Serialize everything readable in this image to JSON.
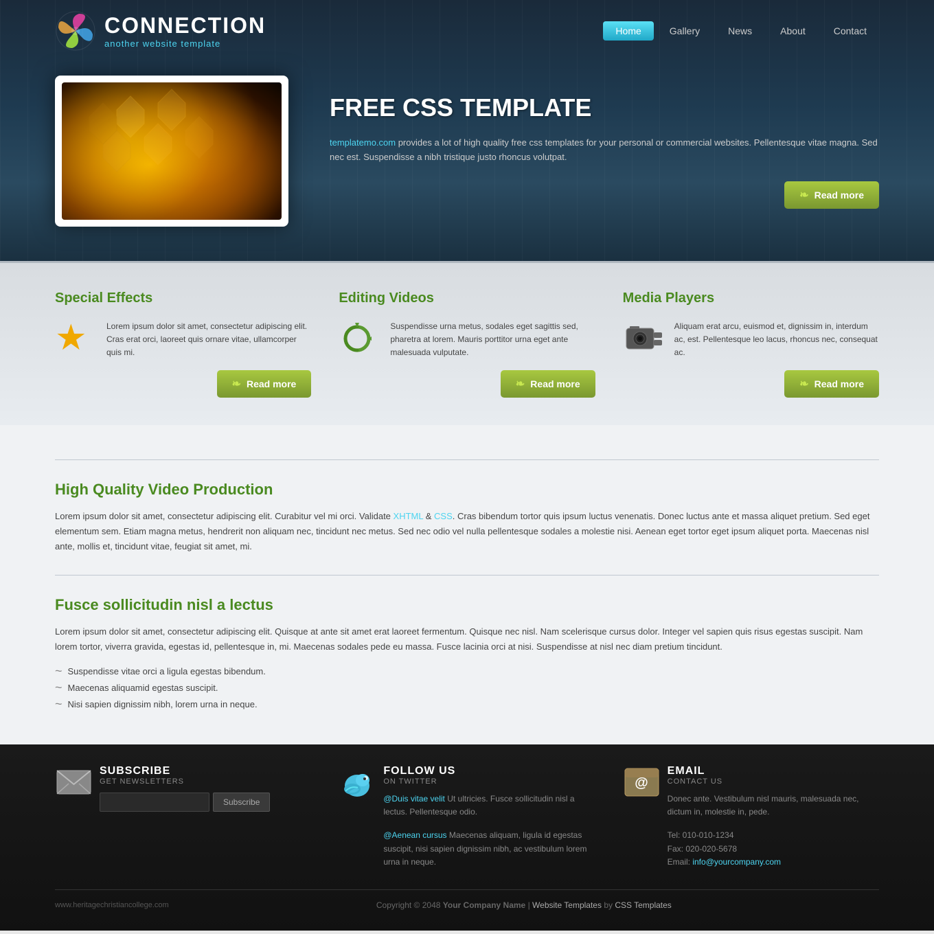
{
  "site": {
    "title": "CONNECTION",
    "subtitle": "another website template",
    "url": "www.heritagechristiancollege.com"
  },
  "nav": {
    "items": [
      {
        "label": "Home",
        "active": true
      },
      {
        "label": "Gallery",
        "active": false
      },
      {
        "label": "News",
        "active": false
      },
      {
        "label": "About",
        "active": false
      },
      {
        "label": "Contact",
        "active": false
      }
    ]
  },
  "hero": {
    "title": "FREE CSS TEMPLATE",
    "link_text": "templatemo.com",
    "description": " provides a lot of high quality free css templates for your personal or commercial websites. Pellentesque vitae magna. Sed nec est. Suspendisse a nibh tristique justo rhoncus volutpat.",
    "read_more": "Read more"
  },
  "features": {
    "items": [
      {
        "title": "Special Effects",
        "text": "Lorem ipsum dolor sit amet, consectetur adipiscing elit. Cras erat orci, laoreet quis ornare vitae, ullamcorper quis mi.",
        "read_more": "Read more",
        "icon": "star"
      },
      {
        "title": "Editing Videos",
        "text": "Suspendisse urna metus, sodales eget sagittis sed, pharetra at lorem. Mauris porttitor urna eget ante malesuada vulputate.",
        "read_more": "Read more",
        "icon": "refresh"
      },
      {
        "title": "Media Players",
        "text": "Aliquam erat arcu, euismod et, dignissim in, interdum ac, est. Pellentesque leo lacus, rhoncus nec, consequat ac.",
        "read_more": "Read more",
        "icon": "camera"
      }
    ]
  },
  "content": [
    {
      "title": "High Quality Video Production",
      "text1": "Lorem ipsum dolor sit amet, consectetur adipiscing elit. Curabitur vel mi orci. Validate ",
      "link1": "XHTML",
      "text2": " & ",
      "link2": "CSS",
      "text3": ". Cras bibendum tortor quis ipsum luctus venenatis. Donec luctus ante et massa aliquet pretium. Sed eget elementum sem. Etiam magna metus, hendrerit non aliquam nec, tincidunt nec metus. Sed nec odio vel nulla pellentesque sodales a molestie nisi. Aenean eget tortor eget ipsum aliquet porta. Maecenas nisl ante, mollis et, tincidunt vitae, feugiat sit amet, mi."
    },
    {
      "title": "Fusce sollicitudin nisl a lectus",
      "paragraph": "Lorem ipsum dolor sit amet, consectetur adipiscing elit. Quisque at ante sit amet erat laoreet fermentum. Quisque nec nisl. Nam scelerisque cursus dolor. Integer vel sapien quis risus egestas suscipit. Nam lorem tortor, viverra gravida, egestas id, pellentesque in, mi. Maecenas sodales pede eu massa. Fusce lacinia orci at nisi. Suspendisse at nisl nec diam pretium tincidunt.",
      "list": [
        "Suspendisse vitae orci a ligula egestas bibendum.",
        "Maecenas aliquamid egestas suscipit.",
        "Nisi sapien dignissim nibh, lorem urna in neque."
      ]
    }
  ],
  "footer": {
    "subscribe": {
      "title": "SUBSCRIBE",
      "subtitle": "GET NEWSLETTERS",
      "placeholder": "",
      "btn_label": "Subscribe"
    },
    "follow": {
      "title": "FOLLOW US",
      "subtitle": "ON TWITTER",
      "tweet1_user": "@Duis vitae velit",
      "tweet1_text": " Ut ultricies. Fusce sollicitudin nisl a lectus. Pellentesque odio.",
      "tweet2_user": "@Aenean cursus",
      "tweet2_text": " Maecenas aliquam, ligula id egestas suscipit, nisi sapien dignissim nibh, ac vestibulum lorem urna in neque."
    },
    "email": {
      "title": "EMAIL",
      "subtitle": "CONTACT US",
      "text": "Donec ante. Vestibulum nisl mauris, malesuada nec, dictum in, molestie in, pede.",
      "tel": "Tel: 010-010-1234",
      "fax": "Fax: 020-020-5678",
      "email_label": "Email: ",
      "email_addr": "info@yourcompany.com"
    },
    "copyright": "Copyright © 2048 ",
    "company": "Your Company Name",
    "sep1": " | ",
    "wt_label": "Website Templates",
    "sep2": " by ",
    "css_label": "CSS Templates"
  }
}
